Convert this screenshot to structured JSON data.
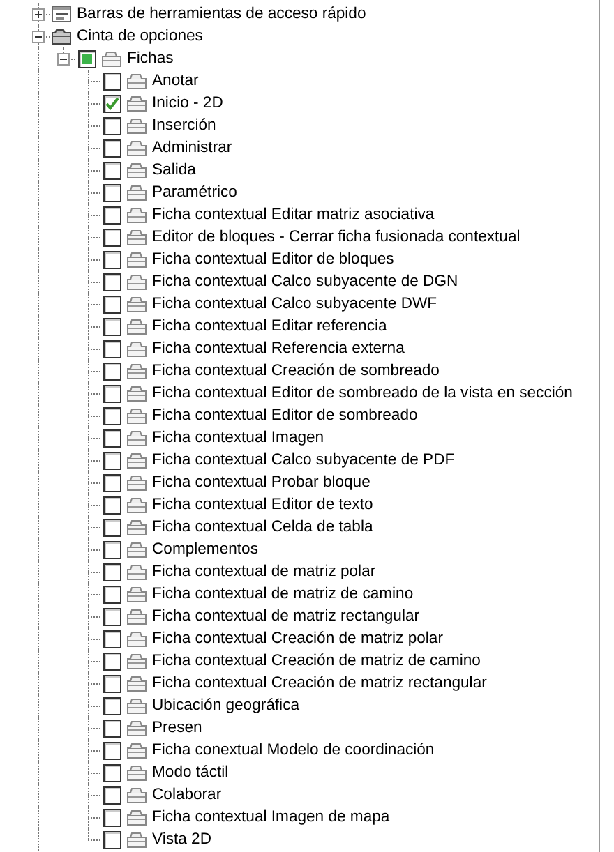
{
  "tree": [
    {
      "kind": "toolbars",
      "label": "Barras de herramientas de acceso rápido",
      "expanded": false
    },
    {
      "kind": "ribbon",
      "label": "Cinta de opciones",
      "expanded": true,
      "children": [
        {
          "kind": "tabs",
          "label": "Fichas",
          "expanded": true,
          "checked": false,
          "indeterminate": true,
          "children": [
            {
              "kind": "tab",
              "label": "Anotar",
              "checked": false
            },
            {
              "kind": "tab",
              "label": "Inicio - 2D",
              "checked": true
            },
            {
              "kind": "tab",
              "label": "Inserción",
              "checked": false
            },
            {
              "kind": "tab",
              "label": "Administrar",
              "checked": false
            },
            {
              "kind": "tab",
              "label": "Salida",
              "checked": false
            },
            {
              "kind": "tab",
              "label": "Paramétrico",
              "checked": false
            },
            {
              "kind": "tab",
              "label": "Ficha contextual Editar matriz asociativa",
              "checked": false
            },
            {
              "kind": "tab",
              "label": "Editor de bloques - Cerrar ficha fusionada contextual",
              "checked": false
            },
            {
              "kind": "tab",
              "label": "Ficha contextual Editor de bloques",
              "checked": false
            },
            {
              "kind": "tab",
              "label": "Ficha contextual Calco subyacente de DGN",
              "checked": false
            },
            {
              "kind": "tab",
              "label": "Ficha contextual Calco subyacente DWF",
              "checked": false
            },
            {
              "kind": "tab",
              "label": "Ficha contextual Editar referencia",
              "checked": false
            },
            {
              "kind": "tab",
              "label": "Ficha contextual Referencia externa",
              "checked": false
            },
            {
              "kind": "tab",
              "label": "Ficha contextual Creación de sombreado",
              "checked": false
            },
            {
              "kind": "tab",
              "label": "Ficha contextual Editor de sombreado de la vista en sección",
              "checked": false
            },
            {
              "kind": "tab",
              "label": "Ficha contextual Editor de sombreado",
              "checked": false
            },
            {
              "kind": "tab",
              "label": "Ficha contextual Imagen",
              "checked": false
            },
            {
              "kind": "tab",
              "label": "Ficha contextual Calco subyacente de PDF",
              "checked": false
            },
            {
              "kind": "tab",
              "label": "Ficha contextual Probar bloque",
              "checked": false
            },
            {
              "kind": "tab",
              "label": "Ficha contextual Editor de texto",
              "checked": false
            },
            {
              "kind": "tab",
              "label": "Ficha contextual Celda de tabla",
              "checked": false
            },
            {
              "kind": "tab",
              "label": "Complementos",
              "checked": false
            },
            {
              "kind": "tab",
              "label": "Ficha contextual de matriz polar",
              "checked": false
            },
            {
              "kind": "tab",
              "label": "Ficha contextual de matriz de camino",
              "checked": false
            },
            {
              "kind": "tab",
              "label": "Ficha contextual de matriz rectangular",
              "checked": false
            },
            {
              "kind": "tab",
              "label": "Ficha contextual Creación de matriz polar",
              "checked": false
            },
            {
              "kind": "tab",
              "label": "Ficha contextual Creación de matriz de camino",
              "checked": false
            },
            {
              "kind": "tab",
              "label": "Ficha contextual Creación de matriz rectangular",
              "checked": false
            },
            {
              "kind": "tab",
              "label": "Ubicación geográfica",
              "checked": false
            },
            {
              "kind": "tab",
              "label": "Presen",
              "checked": false
            },
            {
              "kind": "tab",
              "label": "Ficha conextual Modelo de coordinación",
              "checked": false
            },
            {
              "kind": "tab",
              "label": "Modo táctil",
              "checked": false
            },
            {
              "kind": "tab",
              "label": "Colaborar",
              "checked": false
            },
            {
              "kind": "tab",
              "label": "Ficha contextual Imagen de mapa",
              "checked": false
            },
            {
              "kind": "tab",
              "label": "Vista 2D",
              "checked": false
            }
          ]
        }
      ]
    }
  ]
}
